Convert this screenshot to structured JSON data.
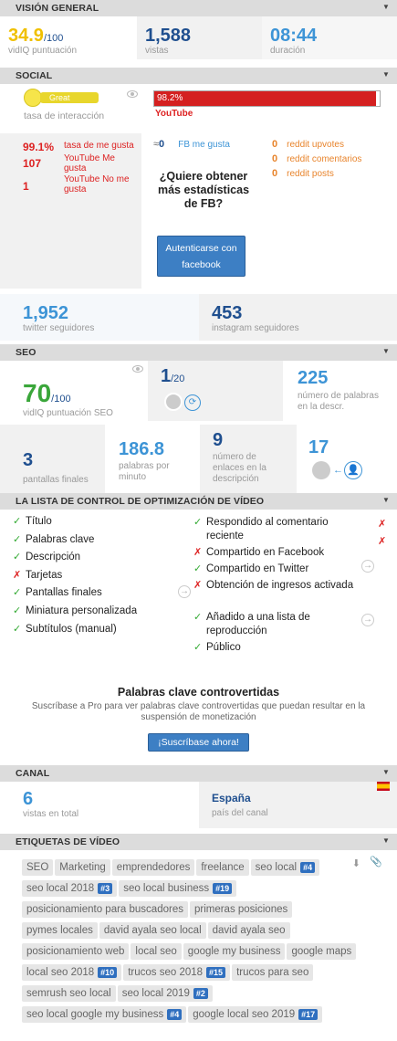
{
  "vision_general": {
    "title": "VISIÓN GENERAL",
    "score": "34.9",
    "score_max": "/100",
    "score_label": "vidIQ puntuación",
    "views": "1,588",
    "views_label": "vistas",
    "duration": "08:44",
    "duration_label": "duración"
  },
  "social": {
    "title": "SOCIAL",
    "interaction_badge": "Great",
    "interaction_label": "tasa de interacción",
    "youtube_percent": "98.2%",
    "youtube_percent_value": 0.982,
    "youtube_label": "YouTube",
    "likes_rate": "99.1%",
    "likes_rate_label": "tasa de me gusta",
    "likes": "107",
    "likes_label": "YouTube Me gusta",
    "dislikes": "1",
    "dislikes_label": "YouTube No me gusta",
    "fb_prefix": "≈",
    "fb_likes": "0",
    "fb_likes_label": "FB me gusta",
    "fb_prompt": "¿Quiere obtener más estadísticas de FB?",
    "fb_button": "Autenticarse con facebook",
    "reddit_upvotes": "0",
    "reddit_upvotes_label": "reddit upvotes",
    "reddit_comments": "0",
    "reddit_comments_label": "reddit comentarios",
    "reddit_posts": "0",
    "reddit_posts_label": "reddit posts",
    "twitter": "1,952",
    "twitter_label": "twitter seguidores",
    "instagram": "453",
    "instagram_label": "instagram seguidores"
  },
  "seo": {
    "title": "SEO",
    "score": "70",
    "score_max": "/100",
    "score_label": "vidIQ puntuación SEO",
    "rank": "1",
    "rank_max": "/20",
    "desc_words": "225",
    "desc_words_label": "número de palabras en la descr.",
    "end_screens": "3",
    "end_screens_label": "pantallas finales",
    "wpm": "186.8",
    "wpm_label": "palabras por minuto",
    "links": "9",
    "links_label": "número de enlaces en la descripción",
    "subs": "17"
  },
  "checklist": {
    "title": "LA LISTA DE CONTROL DE OPTIMIZACIÓN DE VÍDEO",
    "left": [
      {
        "mark": "✓",
        "label": "Título"
      },
      {
        "mark": "✓",
        "label": "Palabras clave"
      },
      {
        "mark": "✓",
        "label": "Descripción"
      },
      {
        "mark": "✗",
        "label": "Tarjetas"
      },
      {
        "mark": "✓",
        "label": "Pantallas finales"
      },
      {
        "mark": "✓",
        "label": "Miniatura personalizada"
      },
      {
        "mark": "✓",
        "label": "Subtítulos (manual)"
      }
    ],
    "right": [
      {
        "mark": "✓",
        "label": "Respondido al comentario reciente"
      },
      {
        "mark": "✗",
        "label": "Compartido en Facebook"
      },
      {
        "mark": "✓",
        "label": "Compartido en Twitter"
      },
      {
        "mark": "✗",
        "label": "Obtención de ingresos activada"
      },
      {
        "mark": "✓",
        "label": "Añadido a una lista de reproducción"
      },
      {
        "mark": "✓",
        "label": "Público"
      }
    ],
    "far_right": [
      "✗",
      "✗"
    ]
  },
  "controversial": {
    "title": "Palabras clave controvertidas",
    "text": "Suscríbase a Pro para ver palabras clave controvertidas que puedan resultar en la suspensión de monetización",
    "button": "¡Suscríbase ahora!"
  },
  "canal": {
    "title": "CANAL",
    "videos": "6",
    "videos_label": "vistas en total",
    "country": "España",
    "country_label": "país del canal"
  },
  "tags": {
    "title": "ETIQUETAS DE VÍDEO",
    "items": [
      {
        "t": "SEO",
        "r": ""
      },
      {
        "t": "Marketing",
        "r": ""
      },
      {
        "t": "emprendedores",
        "r": ""
      },
      {
        "t": "freelance",
        "r": ""
      },
      {
        "t": "seo local",
        "r": "#4"
      },
      {
        "t": "seo local 2018",
        "r": "#3"
      },
      {
        "t": "seo local business",
        "r": "#19"
      },
      {
        "t": "posicionamiento para buscadores",
        "r": ""
      },
      {
        "t": "primeras posiciones",
        "r": ""
      },
      {
        "t": "pymes locales",
        "r": ""
      },
      {
        "t": "david ayala seo local",
        "r": ""
      },
      {
        "t": "david ayala seo",
        "r": ""
      },
      {
        "t": "posicionamiento web",
        "r": ""
      },
      {
        "t": "local seo",
        "r": ""
      },
      {
        "t": "google my business",
        "r": ""
      },
      {
        "t": "google maps",
        "r": ""
      },
      {
        "t": "local seo 2018",
        "r": "#10"
      },
      {
        "t": "trucos seo 2018",
        "r": "#15"
      },
      {
        "t": "trucos para seo",
        "r": ""
      },
      {
        "t": "semrush seo local",
        "r": ""
      },
      {
        "t": "seo local 2019",
        "r": "#2"
      },
      {
        "t": "seo local google my business",
        "r": "#4"
      },
      {
        "t": "google local seo 2019",
        "r": "#17"
      }
    ]
  },
  "colors": {
    "green": "#3aa63a",
    "red": "#dd2222",
    "blue": "#2f6fbf",
    "header": "#dcdcdc"
  }
}
